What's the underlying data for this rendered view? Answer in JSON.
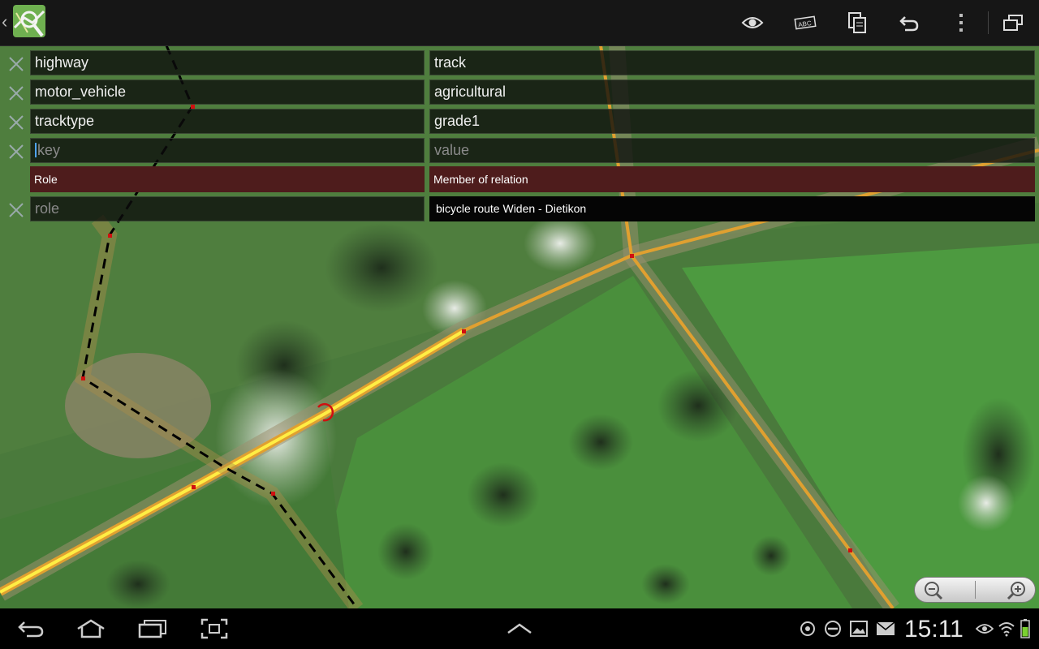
{
  "actionbar": {
    "back_glyph": "‹",
    "logo_icon": "map-magnifier-logo",
    "icons": [
      "eye-icon",
      "spellcheck-abc-icon",
      "copy-icon",
      "undo-icon",
      "overflow-menu-icon",
      "window-icon"
    ]
  },
  "tags": [
    {
      "key": "highway",
      "value": "track"
    },
    {
      "key": "motor_vehicle",
      "value": "agricultural"
    },
    {
      "key": "tracktype",
      "value": "grade1"
    }
  ],
  "new_tag": {
    "key_placeholder": "key",
    "value_placeholder": "value"
  },
  "relations": {
    "role_header": "Role",
    "member_header": "Member of relation",
    "role_placeholder": "role",
    "relation_name": "bicycle route Widen - Dietikon"
  },
  "zoom": {
    "out_icon": "zoom-out-icon",
    "in_icon": "zoom-in-icon"
  },
  "navbar": {
    "icons": [
      "back-icon",
      "home-icon",
      "recent-apps-icon",
      "screenshot-icon",
      "up-chevron-icon"
    ],
    "status_icons": [
      "gps-icon",
      "do-not-disturb-icon",
      "gallery-icon",
      "email-icon",
      "eye-icon",
      "wifi-icon",
      "battery-icon"
    ],
    "time": "15:11"
  },
  "colors": {
    "header_bg": "#4e1c1c",
    "road": "#e0a030",
    "highlight": "#ffee44",
    "actionbar_bg": "#161616"
  }
}
